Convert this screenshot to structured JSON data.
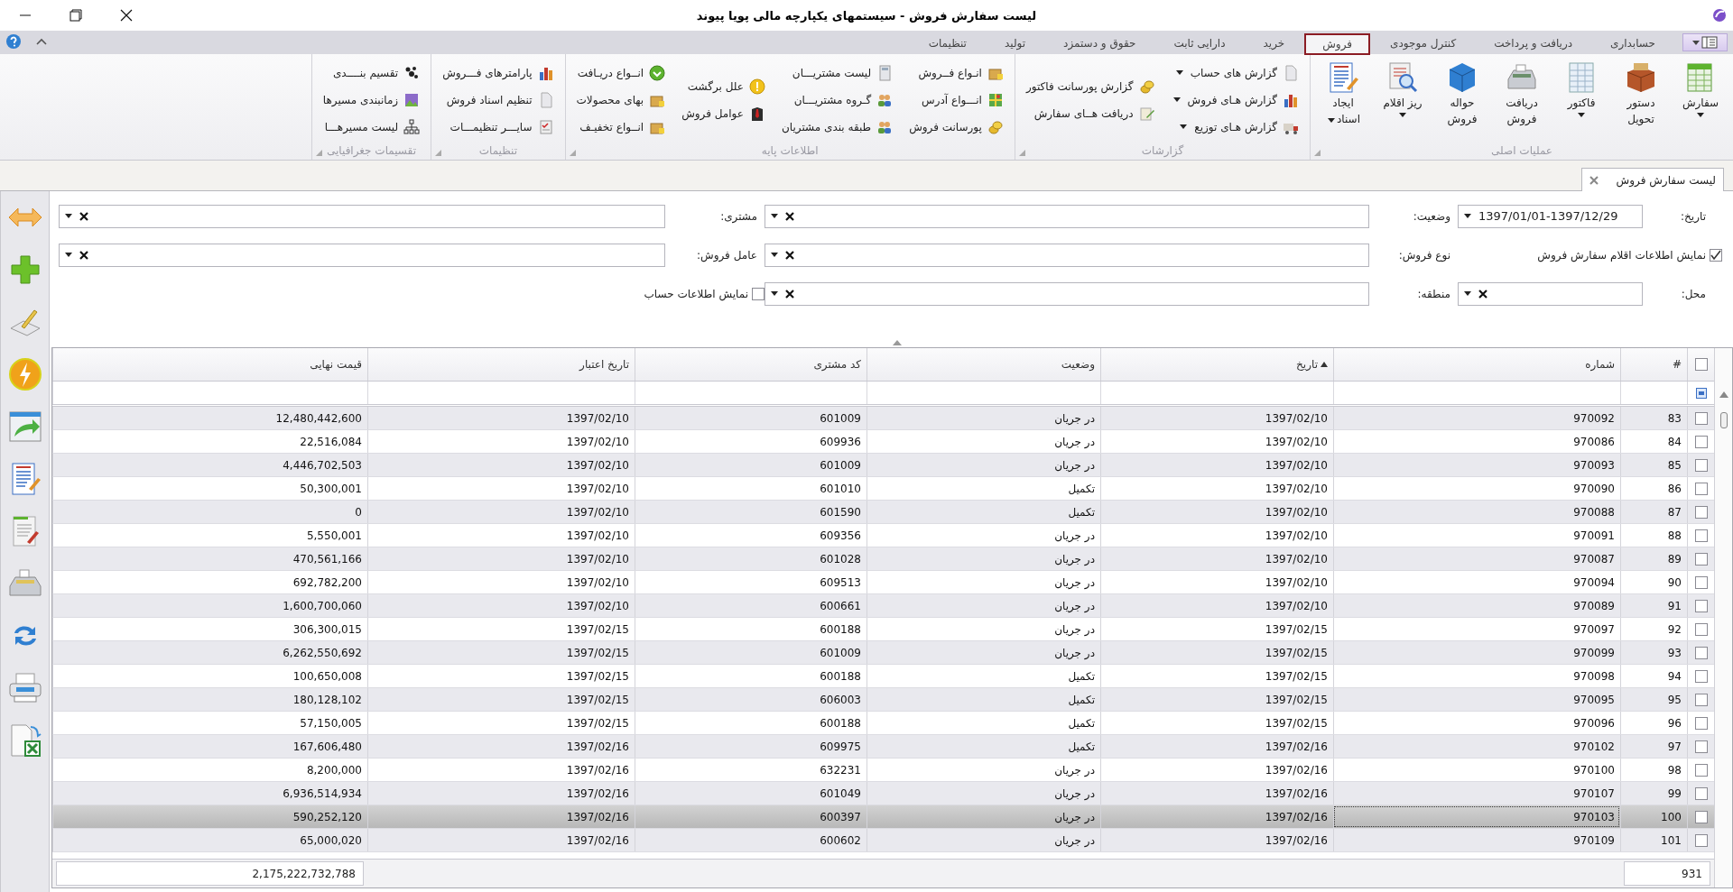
{
  "window": {
    "title": "لیست سفارش فروش - سیستمهای یکپارچه مالی پویا پیوند"
  },
  "ribbon": {
    "tabs": [
      {
        "label": "حسابداری",
        "selected": false
      },
      {
        "label": "دریافت و پرداخت",
        "selected": false
      },
      {
        "label": "کنترل موجودی",
        "selected": false
      },
      {
        "label": "فروش",
        "selected": true
      },
      {
        "label": "خرید",
        "selected": false
      },
      {
        "label": "دارایی ثابت",
        "selected": false
      },
      {
        "label": "حقوق و دستمزد",
        "selected": false
      },
      {
        "label": "تولید",
        "selected": false
      },
      {
        "label": "تنظیمات",
        "selected": false
      }
    ],
    "groups": [
      {
        "title": "عملیات اصلی",
        "buttons": [
          {
            "lines": [
              "سفارش"
            ],
            "dropdown": true
          },
          {
            "lines": [
              "دستور",
              "تحویل"
            ],
            "dropdown": false
          },
          {
            "lines": [
              "فاکتور"
            ],
            "dropdown": true
          },
          {
            "lines": [
              "دریافت",
              "فروش"
            ],
            "dropdown": false
          },
          {
            "lines": [
              "حواله",
              "فروش"
            ],
            "dropdown": false
          },
          {
            "lines": [
              "ریز اقلام"
            ],
            "dropdown": true
          },
          {
            "lines": [
              "ایجاد",
              "اسناد"
            ],
            "dropdown": true
          }
        ]
      },
      {
        "title": "گزارشات",
        "columns": [
          [
            {
              "label": "گزارش های حساب",
              "dropdown": true
            },
            {
              "label": "گزارش هـای فروش",
              "dropdown": true
            },
            {
              "label": "گزارش هـای توزیع",
              "dropdown": true
            }
          ],
          [
            {
              "label": "گزارش پورسانت فاکتور",
              "dropdown": false
            },
            {
              "label": "دریافت هــای سفارش",
              "dropdown": false
            }
          ]
        ]
      },
      {
        "title": "اطلاعات پایه",
        "columns": [
          [
            {
              "label": "انـواع فــروش",
              "dropdown": false
            },
            {
              "label": "انـــواع آدرس",
              "dropdown": false
            },
            {
              "label": "پورسانت فروش",
              "dropdown": false
            }
          ],
          [
            {
              "label": "لیست مشتریـــان",
              "dropdown": false
            },
            {
              "label": "گـروه مشتریـــان",
              "dropdown": false
            },
            {
              "label": "طبقه بندی مشتریان",
              "dropdown": false
            }
          ],
          [
            {
              "label": "علل برگشت",
              "dropdown": false
            },
            {
              "label": "عوامل فروش",
              "dropdown": false
            }
          ],
          [
            {
              "label": "انــواع دریـافت",
              "dropdown": false
            },
            {
              "label": "بهای محصولات",
              "dropdown": false
            },
            {
              "label": "انــواع تخفیـف",
              "dropdown": false
            }
          ]
        ]
      },
      {
        "title": "تنظیمات",
        "columns": [
          [
            {
              "label": "پارامترهای فـــروش",
              "dropdown": false
            },
            {
              "label": "تنظیم اسناد فروش",
              "dropdown": false
            },
            {
              "label": "سایـــر تنظیمـــات",
              "dropdown": false
            }
          ]
        ]
      },
      {
        "title": "تقسیمات جغرافیایی",
        "columns": [
          [
            {
              "label": "تقسیم بنــــدی",
              "dropdown": false
            },
            {
              "label": "زمانبندی مسیرها",
              "dropdown": false
            },
            {
              "label": "لیست مسیرهـــا",
              "dropdown": false
            }
          ]
        ]
      }
    ]
  },
  "document_tab": {
    "label": "لیست سفارش فروش"
  },
  "filters": [
    {
      "kind": "combo",
      "label": "تاریخ:",
      "value": "1397/01/01-1397/12/29",
      "clearable": false
    },
    {
      "kind": "combo",
      "label": "وضعیت:",
      "clearable": true
    },
    {
      "kind": "combo",
      "label": "مشتری:",
      "clearable": true
    },
    {
      "kind": "checkbox",
      "label": "نمایش اطلاعات اقلام سفارش فروش",
      "checked": true
    },
    {
      "kind": "combo",
      "label": "نوع فروش:",
      "clearable": true
    },
    {
      "kind": "combo",
      "label": "عامل فروش:",
      "clearable": true
    },
    {
      "kind": "combo",
      "label": "محل:",
      "clearable": true
    },
    {
      "kind": "combo",
      "label": "منطقه:",
      "clearable": true
    },
    {
      "kind": "checkbox",
      "label": "نمایش اطلاعات حساب",
      "checked": false
    }
  ],
  "table": {
    "select_all": {
      "checked": false
    },
    "columns": [
      {
        "label": "#"
      },
      {
        "label": "شماره"
      },
      {
        "label": "تاریخ",
        "sort_ascending": true
      },
      {
        "label": "وضعیت"
      },
      {
        "label": "کد مشتری"
      },
      {
        "label": "تاریخ اعتبار"
      },
      {
        "label": "قیمت نهایی"
      }
    ],
    "rows": [
      {
        "cells": [
          "83",
          "970092",
          "1397/02/10",
          "در جریان",
          "601009",
          "1397/02/10",
          "12,480,442,600"
        ],
        "selected": false,
        "checked": false
      },
      {
        "cells": [
          "84",
          "970086",
          "1397/02/10",
          "در جریان",
          "609936",
          "1397/02/10",
          "22,516,084"
        ],
        "selected": false,
        "checked": false
      },
      {
        "cells": [
          "85",
          "970093",
          "1397/02/10",
          "در جریان",
          "601009",
          "1397/02/10",
          "4,446,702,503"
        ],
        "selected": false,
        "checked": false
      },
      {
        "cells": [
          "86",
          "970090",
          "1397/02/10",
          "تکمیل",
          "601010",
          "1397/02/10",
          "50,300,001"
        ],
        "selected": false,
        "checked": false
      },
      {
        "cells": [
          "87",
          "970088",
          "1397/02/10",
          "تکمیل",
          "601590",
          "1397/02/10",
          "0"
        ],
        "selected": false,
        "checked": false
      },
      {
        "cells": [
          "88",
          "970091",
          "1397/02/10",
          "در جریان",
          "609356",
          "1397/02/10",
          "5,550,001"
        ],
        "selected": false,
        "checked": false
      },
      {
        "cells": [
          "89",
          "970087",
          "1397/02/10",
          "در جریان",
          "601028",
          "1397/02/10",
          "470,561,166"
        ],
        "selected": false,
        "checked": false
      },
      {
        "cells": [
          "90",
          "970094",
          "1397/02/10",
          "در جریان",
          "609513",
          "1397/02/10",
          "692,782,200"
        ],
        "selected": false,
        "checked": false
      },
      {
        "cells": [
          "91",
          "970089",
          "1397/02/10",
          "در جریان",
          "600661",
          "1397/02/10",
          "1,600,700,060"
        ],
        "selected": false,
        "checked": false
      },
      {
        "cells": [
          "92",
          "970097",
          "1397/02/15",
          "در جریان",
          "600188",
          "1397/02/15",
          "306,300,015"
        ],
        "selected": false,
        "checked": false
      },
      {
        "cells": [
          "93",
          "970099",
          "1397/02/15",
          "در جریان",
          "601009",
          "1397/02/15",
          "6,262,550,692"
        ],
        "selected": false,
        "checked": false
      },
      {
        "cells": [
          "94",
          "970098",
          "1397/02/15",
          "تکمیل",
          "600188",
          "1397/02/15",
          "100,650,008"
        ],
        "selected": false,
        "checked": false
      },
      {
        "cells": [
          "95",
          "970095",
          "1397/02/15",
          "تکمیل",
          "606003",
          "1397/02/15",
          "180,128,102"
        ],
        "selected": false,
        "checked": false
      },
      {
        "cells": [
          "96",
          "970096",
          "1397/02/15",
          "تکمیل",
          "600188",
          "1397/02/15",
          "57,150,005"
        ],
        "selected": false,
        "checked": false
      },
      {
        "cells": [
          "97",
          "970102",
          "1397/02/16",
          "تکمیل",
          "609975",
          "1397/02/16",
          "167,606,480"
        ],
        "selected": false,
        "checked": false
      },
      {
        "cells": [
          "98",
          "970100",
          "1397/02/16",
          "در جریان",
          "632231",
          "1397/02/16",
          "8,200,000"
        ],
        "selected": false,
        "checked": false
      },
      {
        "cells": [
          "99",
          "970107",
          "1397/02/16",
          "در جریان",
          "601049",
          "1397/02/16",
          "6,936,514,934"
        ],
        "selected": false,
        "checked": false
      },
      {
        "cells": [
          "100",
          "970103",
          "1397/02/16",
          "در جریان",
          "600397",
          "1397/02/16",
          "590,252,120"
        ],
        "selected": true,
        "checked": false
      },
      {
        "cells": [
          "101",
          "970109",
          "1397/02/16",
          "در جریان",
          "600602",
          "1397/02/16",
          "65,000,020"
        ],
        "selected": false,
        "checked": false
      }
    ]
  },
  "footer": {
    "count": "931",
    "total": "2,175,222,732,788"
  }
}
